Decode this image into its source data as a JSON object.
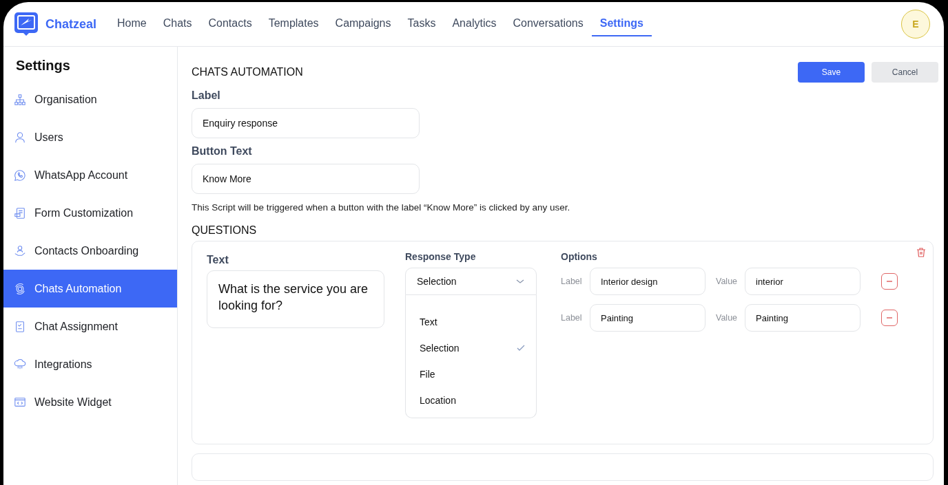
{
  "app": {
    "name": "Chatzeal"
  },
  "nav": [
    {
      "label": "Home",
      "selected": false
    },
    {
      "label": "Chats",
      "selected": false
    },
    {
      "label": "Contacts",
      "selected": false
    },
    {
      "label": "Templates",
      "selected": false
    },
    {
      "label": "Campaigns",
      "selected": false
    },
    {
      "label": "Tasks",
      "selected": false
    },
    {
      "label": "Analytics",
      "selected": false
    },
    {
      "label": "Conversations",
      "selected": false
    },
    {
      "label": "Settings",
      "selected": true
    }
  ],
  "avatar": {
    "initial": "E"
  },
  "sidebar": {
    "title": "Settings",
    "items": [
      {
        "label": "Organisation",
        "selected": false
      },
      {
        "label": "Users",
        "selected": false
      },
      {
        "label": "WhatsApp Account",
        "selected": false
      },
      {
        "label": "Form Customization",
        "selected": false
      },
      {
        "label": "Contacts Onboarding",
        "selected": false
      },
      {
        "label": "Chats Automation",
        "selected": true
      },
      {
        "label": "Chat Assignment",
        "selected": false
      },
      {
        "label": "Integrations",
        "selected": false
      },
      {
        "label": "Website Widget",
        "selected": false
      }
    ]
  },
  "page": {
    "title": "CHATS AUTOMATION",
    "buttons": [
      {
        "label": "Save",
        "kind": "primary"
      },
      {
        "label": "Cancel",
        "kind": "secondary"
      }
    ]
  },
  "form": {
    "fields": [
      {
        "label": "Label",
        "value": "Enquiry response"
      },
      {
        "label": "Button Text",
        "value": "Know More"
      }
    ],
    "hint": "This Script will be triggered when a button with the label “Know More” is clicked by any user."
  },
  "questions": {
    "title": "QUESTIONS",
    "items": [
      {
        "text_label": "Text",
        "text": "What is the service you are looking for?",
        "response_type_label": "Response Type",
        "response_type": "Selection",
        "expanded": true,
        "response_options": [
          {
            "label": "Text",
            "selected": false
          },
          {
            "label": "Selection",
            "selected": true
          },
          {
            "label": "File",
            "selected": false
          },
          {
            "label": "Location",
            "selected": false
          }
        ],
        "options_label": "Options",
        "options": [
          {
            "label_caption": "Label",
            "label": "Interior design",
            "value_caption": "Value",
            "value": "interior"
          },
          {
            "label_caption": "Label",
            "label": "Painting",
            "value_caption": "Value",
            "value": "Painting"
          }
        ]
      }
    ]
  }
}
